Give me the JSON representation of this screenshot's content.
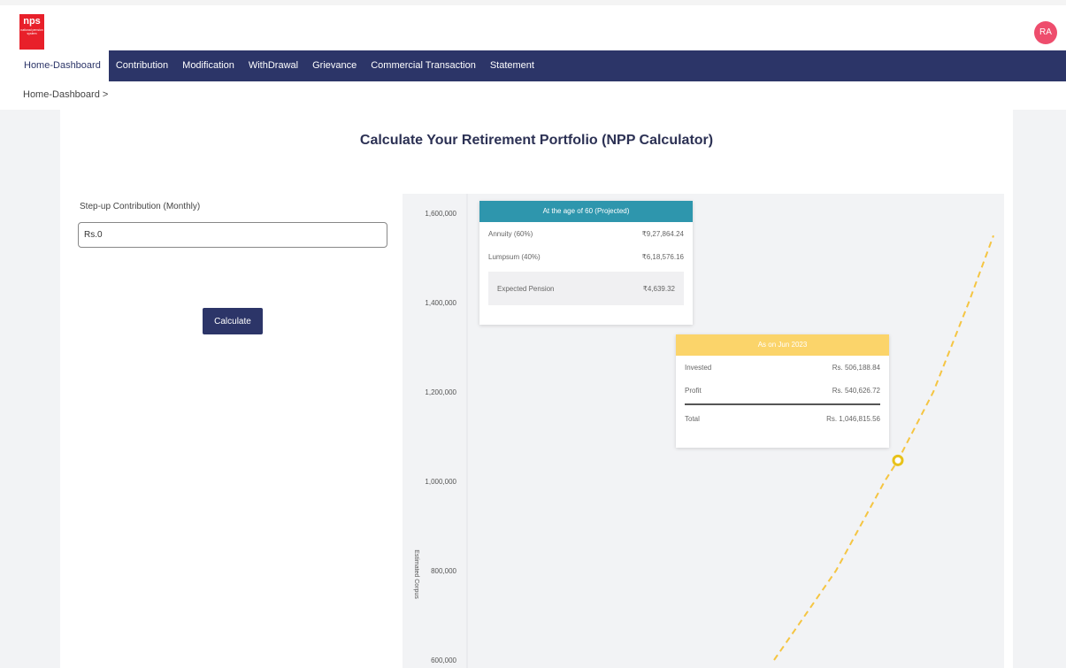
{
  "header": {
    "logo_text": "nps",
    "logo_sub": "national pension system",
    "avatar": "RA"
  },
  "nav": {
    "items": [
      "Home-Dashboard",
      "Contribution",
      "Modification",
      "WithDrawal",
      "Grievance",
      "Commercial Transaction",
      "Statement"
    ],
    "active": "Home-Dashboard"
  },
  "breadcrumb": "Home-Dashboard >",
  "page": {
    "title": "Calculate Your Retirement Portfolio (NPP Calculator)"
  },
  "form": {
    "label": "Step-up Contribution (Monthly)",
    "value": "Rs.0",
    "button": "Calculate"
  },
  "projected_card": {
    "title": "At the age of 60 (Projected)",
    "rows": [
      {
        "label": "Annuity (60%)",
        "value": "₹9,27,864.24"
      },
      {
        "label": "Lumpsum (40%)",
        "value": "₹6,18,576.16"
      }
    ],
    "pension_label": "Expected Pension",
    "pension_value": "₹4,639.32"
  },
  "current_card": {
    "title": "As on Jun 2023",
    "rows": [
      {
        "label": "Invested",
        "value": "Rs. 506,188.84"
      },
      {
        "label": "Profit",
        "value": "Rs. 540,626.72"
      }
    ],
    "total_label": "Total",
    "total_value": "Rs. 1,046,815.56"
  },
  "chart_data": {
    "type": "line",
    "ylabel": "Estimated Corpus",
    "yticks": [
      600000,
      800000,
      1000000,
      1200000,
      1400000,
      1600000
    ],
    "ytick_labels": [
      "600,000",
      "800,000",
      "1,000,000",
      "1,200,000",
      "1,400,000",
      "1,600,000"
    ],
    "ylim": [
      600000,
      1600000
    ],
    "series": [
      {
        "style": "dashed",
        "color": "#f5c542",
        "points_y": [
          600000,
          800000,
          1000000,
          1046815.56,
          1200000,
          1400000,
          1550000
        ]
      }
    ],
    "marker": {
      "y": 1046815.56,
      "color": "#e8c21a"
    }
  }
}
